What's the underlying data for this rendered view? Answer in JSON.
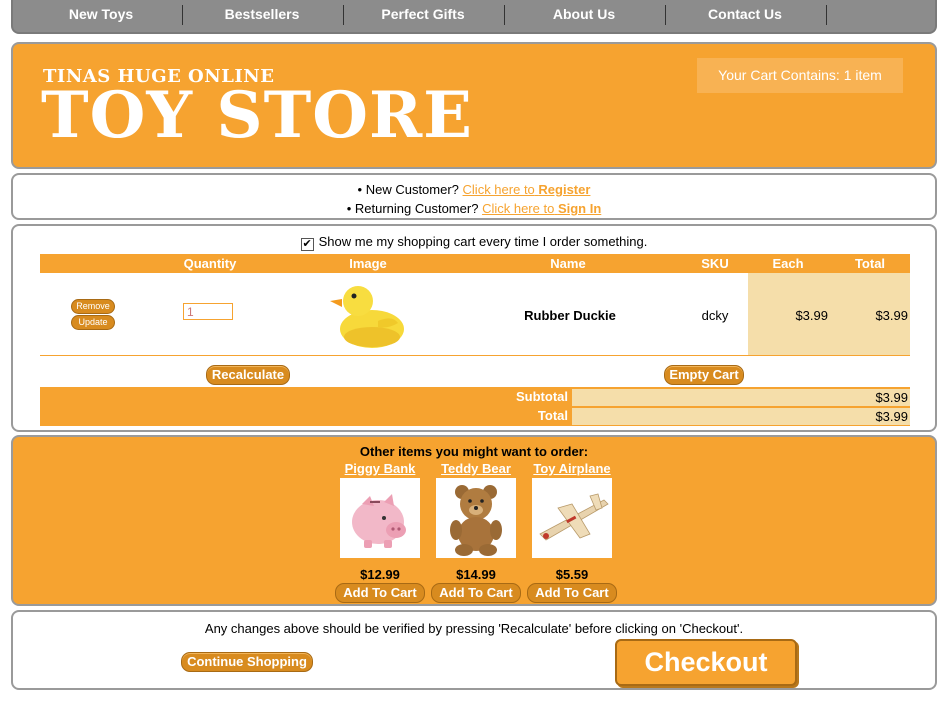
{
  "nav": {
    "items": [
      {
        "label": "New Toys"
      },
      {
        "label": "Bestsellers"
      },
      {
        "label": "Perfect Gifts"
      },
      {
        "label": "About Us"
      },
      {
        "label": "Contact Us"
      }
    ]
  },
  "header": {
    "subtitle": "TINAS HUGE ONLINE",
    "title": "TOY STORE",
    "cart_status": "Your Cart Contains: 1 item"
  },
  "login": {
    "new_prefix": "• New Customer?",
    "new_link_pre": "Click here to",
    "new_link_bold": "Register",
    "returning_prefix": "• Returning Customer?",
    "returning_link_pre": "Click here to",
    "returning_link_bold": "Sign In"
  },
  "cart": {
    "show_cart_label": "Show me my shopping cart every time I order something.",
    "show_cart_checked": "✔",
    "columns": {
      "quantity": "Quantity",
      "image": "Image",
      "name": "Name",
      "sku": "SKU",
      "each": "Each",
      "total": "Total"
    },
    "item": {
      "remove_label": "Remove",
      "update_label": "Update",
      "quantity": "1",
      "name": "Rubber Duckie",
      "sku": "dcky",
      "each": "$3.99",
      "total": "$3.99"
    },
    "recalculate_label": "Recalculate",
    "empty_label": "Empty Cart",
    "subtotal_label": "Subtotal",
    "subtotal_value": "$3.99",
    "total_label": "Total",
    "total_value": "$3.99"
  },
  "reco": {
    "title": "Other items you might want to order:",
    "items": [
      {
        "name": "Piggy Bank",
        "price": "$12.99",
        "button": "Add To Cart"
      },
      {
        "name": "Teddy Bear",
        "price": "$14.99",
        "button": "Add To Cart"
      },
      {
        "name": "Toy Airplane",
        "price": "$5.59",
        "button": "Add To Cart"
      }
    ]
  },
  "footer": {
    "note": "Any changes above should be verified by pressing 'Recalculate' before clicking on 'Checkout'.",
    "continue_label": "Continue Shopping",
    "checkout_label": "Checkout"
  },
  "colors": {
    "brand_orange": "#f6a330",
    "button_orange": "#d88b1f",
    "nav_gray": "#8c8c8c",
    "cell_tan": "#f5deaa"
  }
}
